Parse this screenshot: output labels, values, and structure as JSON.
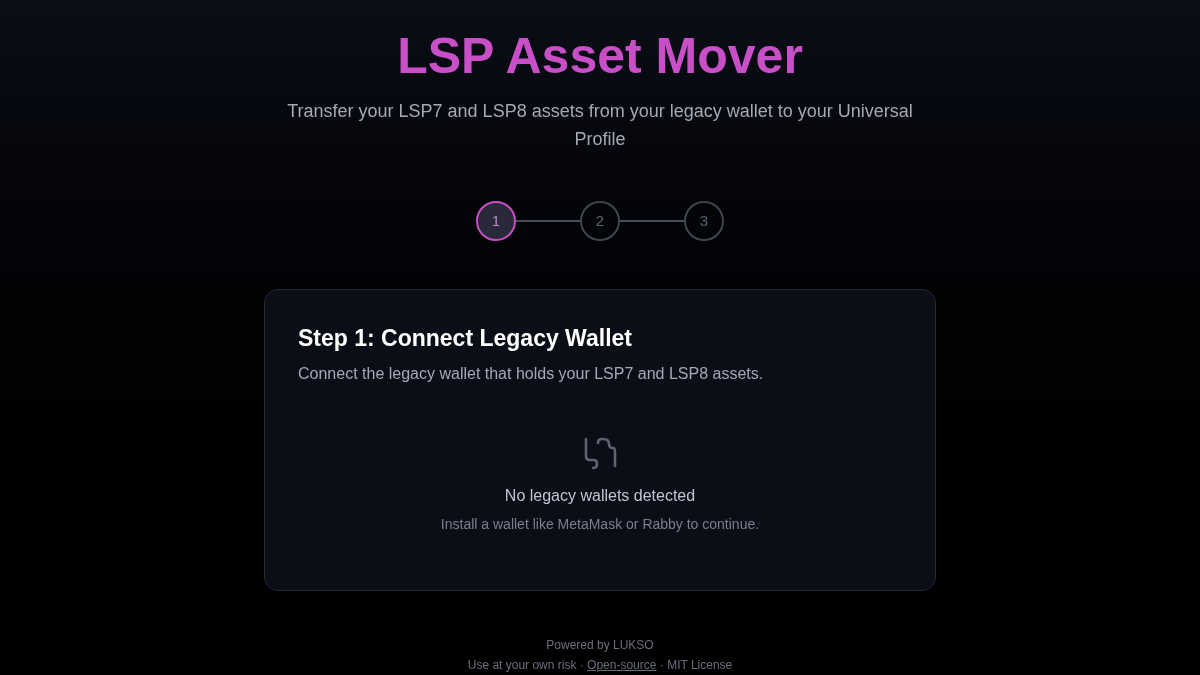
{
  "header": {
    "title": "LSP Asset Mover",
    "subtitle": "Transfer your LSP7 and LSP8 assets from your legacy wallet to your Universal Profile"
  },
  "steps": [
    {
      "label": "1",
      "selected": true
    },
    {
      "label": "2",
      "selected": false
    },
    {
      "label": "3",
      "selected": false
    }
  ],
  "card": {
    "title": "Step 1: Connect Legacy Wallet",
    "description": "Connect the legacy wallet that holds your LSP7 and LSP8 assets.",
    "empty_title": "No legacy wallets detected",
    "empty_hint": "Install a wallet like MetaMask or Rabby to continue."
  },
  "footer": {
    "powered": "Powered by LUKSO",
    "risk": "Use at your own risk · ",
    "link": "Open-source",
    "license": " · MIT License"
  }
}
